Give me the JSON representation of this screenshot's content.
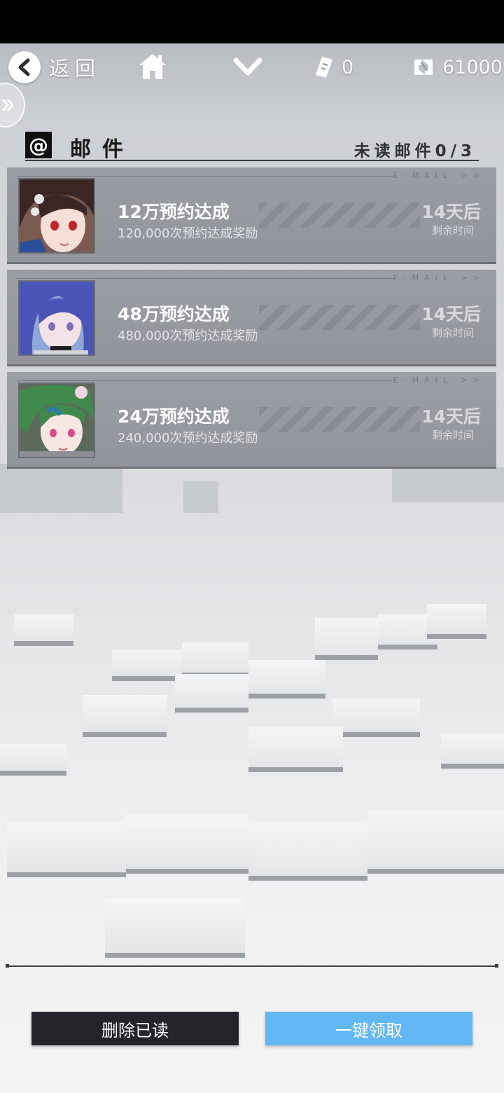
{
  "topbar": {
    "back_label": "返回",
    "ticket_count": "0",
    "currency_amount": "61000"
  },
  "mail": {
    "header_title": "邮件",
    "unread_label": "未读邮件0/3",
    "tag": "E-MAIL >>",
    "items": [
      {
        "title": "12万预约达成",
        "subtitle": "120,000次预约达成奖励",
        "days": "14天后",
        "remain_label": "剩余时间"
      },
      {
        "title": "48万预约达成",
        "subtitle": "480,000次预约达成奖励",
        "days": "14天后",
        "remain_label": "剩余时间"
      },
      {
        "title": "24万预约达成",
        "subtitle": "240,000次预约达成奖励",
        "days": "14天后",
        "remain_label": "剩余时间"
      }
    ]
  },
  "buttons": {
    "delete_read": "删除已读",
    "claim_all": "一键领取"
  },
  "colors": {
    "claim_button": "#62b8f4",
    "delete_button": "#23252b"
  },
  "icons": {
    "back": "chevron-left-icon",
    "home": "home-icon",
    "expand": "chevron-down-icon",
    "ticket": "ticket-icon",
    "currency": "currency-icon",
    "side_tab": "double-chevron-right-icon",
    "mail_header": "at-icon"
  }
}
